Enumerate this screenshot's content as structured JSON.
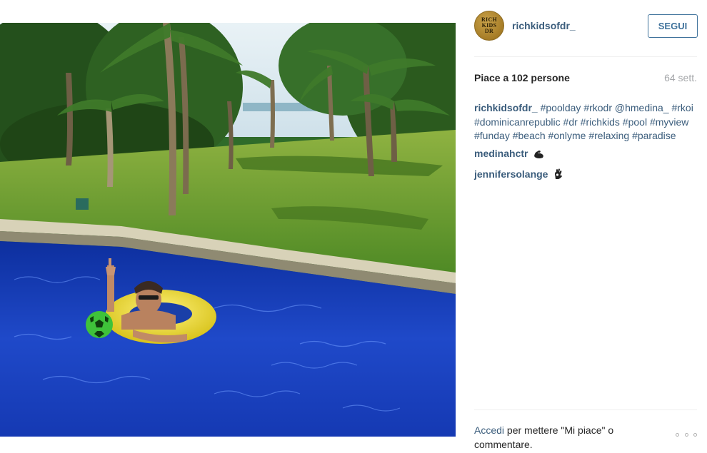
{
  "post": {
    "image_alt": "Man in a yellow pool float with a green soccer ball in a blue swimming pool surrounded by palm trees and a lawn"
  },
  "header": {
    "avatar_mark_lines": [
      "RICH",
      "KIDS",
      "DR"
    ],
    "username": "richkidsofdr_",
    "follow_label": "SEGUI"
  },
  "meta": {
    "likes": "Piace a 102 persone",
    "time": "64 sett."
  },
  "caption": {
    "author": "richkidsofdr_",
    "items": [
      "#poolday",
      "#rkodr",
      "@hmedina_",
      "#rkoi",
      "#dominicanrepublic",
      "#dr",
      "#richkids",
      "#pool",
      "#myview",
      "#funday",
      "#beach",
      "#onlyme",
      "#relaxing",
      "#paradise"
    ]
  },
  "comments": [
    {
      "author": "medinahctr",
      "emoji": "flexed-biceps-icon"
    },
    {
      "author": "jennifersolange",
      "emoji": "ok-hand-icon"
    }
  ],
  "footer": {
    "login_link": "Accedi",
    "login_rest": " per mettere \"Mi piace\" o commentare.",
    "more_icon": "more-options-icon"
  },
  "colors": {
    "link": "#3b5d7c",
    "button": "#3f729b",
    "time": "#a5a7aa"
  }
}
